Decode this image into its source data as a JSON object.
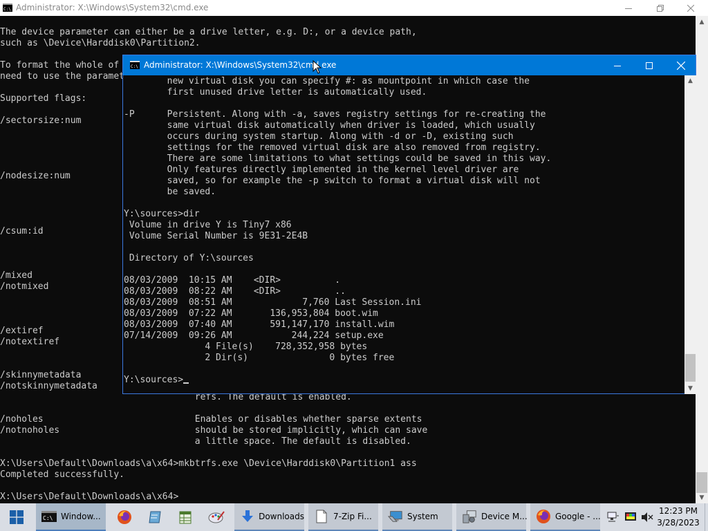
{
  "background_window": {
    "title": "Administrator: X:\\Windows\\System32\\cmd.exe",
    "console_lines": [
      "The device parameter can either be a drive letter, e.g. D:, or a device path,",
      "such as \\Device\\Harddisk0\\Partition2.",
      "",
      "To format the whole of",
      "need to use the paramet",
      "",
      "Supported flags:",
      "",
      "/sectorsize:num",
      "",
      "",
      "",
      "",
      "/nodesize:num",
      "",
      "",
      "",
      "",
      "/csum:id",
      "",
      "",
      "",
      "/mixed",
      "/notmixed",
      "",
      "",
      "",
      "/extiref",
      "/notextiref",
      "",
      "",
      "/skinnymetadata",
      "/notskinnymetadata",
      "                                    refs. The default is enabled.",
      "",
      "/noholes                            Enables or disables whether sparse extents",
      "/notnoholes                         should be stored implicitly, which can save",
      "                                    a little space. The default is disabled.",
      "",
      "X:\\Users\\Default\\Downloads\\a\\x64>mkbtrfs.exe \\Device\\Harddisk0\\Partition1 ass",
      "Completed successfully.",
      "",
      "X:\\Users\\Default\\Downloads\\a\\x64>"
    ]
  },
  "foreground_window": {
    "title": "Administrator: X:\\Windows\\System32\\cmd.exe",
    "console_lines": [
      "        new virtual disk you can specify #: as mountpoint in which case the",
      "        first unused drive letter is automatically used.",
      "",
      "-P      Persistent. Along with -a, saves registry settings for re-creating the",
      "        same virtual disk automatically when driver is loaded, which usually",
      "        occurs during system startup. Along with -d or -D, existing such",
      "        settings for the removed virtual disk are also removed from registry.",
      "        There are some limitations to what settings could be saved in this way.",
      "        Only features directly implemented in the kernel level driver are",
      "        saved, so for example the -p switch to format a virtual disk will not",
      "        be saved.",
      "",
      "Y:\\sources>dir",
      " Volume in drive Y is Tiny7 x86",
      " Volume Serial Number is 9E31-2E4B",
      "",
      " Directory of Y:\\sources",
      "",
      "08/03/2009  10:15 AM    <DIR>          .",
      "08/03/2009  08:22 AM    <DIR>          ..",
      "08/03/2009  08:51 AM             7,760 Last Session.ini",
      "08/03/2009  07:22 AM       136,953,804 boot.wim",
      "08/03/2009  07:40 AM       591,147,170 install.wim",
      "07/14/2009  09:26 AM           244,224 setup.exe",
      "               4 File(s)    728,352,958 bytes",
      "               2 Dir(s)               0 bytes free",
      ""
    ],
    "prompt": "Y:\\sources>"
  },
  "taskbar": {
    "start_icon": "windows-logo-icon",
    "pinned": [
      {
        "icon": "firefox-icon"
      },
      {
        "icon": "notepad-icon"
      },
      {
        "icon": "spreadsheet-icon"
      },
      {
        "icon": "paint-icon"
      }
    ],
    "apps": [
      {
        "label": "Window...",
        "icon": "cmd-icon"
      },
      {
        "label": "Downloads",
        "icon": "download-arrow-icon"
      },
      {
        "label": "7-Zip Fi...",
        "icon": "document-icon"
      },
      {
        "label": "System",
        "icon": "system-icon"
      },
      {
        "label": "Device M...",
        "icon": "device-manager-icon"
      },
      {
        "label": "Google - ...",
        "icon": "firefox-icon"
      }
    ],
    "tray": {
      "time": "12:23 PM",
      "date": "3/28/2023"
    }
  },
  "colors": {
    "console_bg": "#0c0c0c",
    "console_text": "#cccccc",
    "active_titlebar": "#0078d7",
    "taskbar_bg": "#d9dde4"
  }
}
